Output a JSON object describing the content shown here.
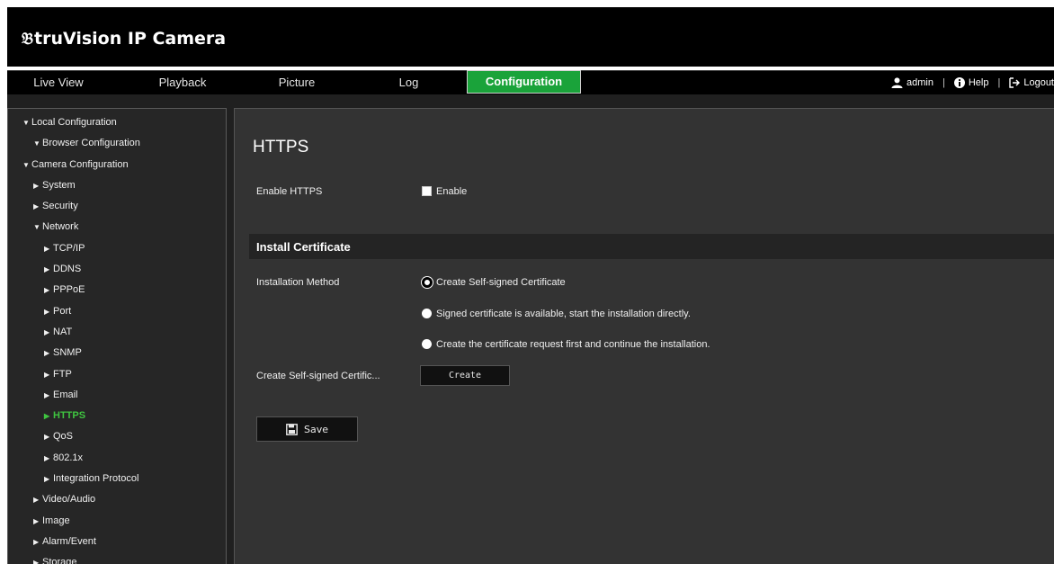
{
  "header": {
    "logo_mark": "𝔅",
    "logo_text": "truVision  IP Camera"
  },
  "nav": {
    "tabs": [
      {
        "label": "Live View"
      },
      {
        "label": "Playback"
      },
      {
        "label": "Picture"
      },
      {
        "label": "Log"
      },
      {
        "label": "Configuration"
      }
    ],
    "user": "admin",
    "help": "Help",
    "logout": "Logout",
    "sep": "|"
  },
  "sidebar": {
    "items": [
      {
        "label": "Local Configuration",
        "indent": 0,
        "expanded": true
      },
      {
        "label": "Browser Configuration",
        "indent": 1,
        "expanded": true
      },
      {
        "label": "Camera Configuration",
        "indent": 0,
        "expanded": true
      },
      {
        "label": "System",
        "indent": 1,
        "expanded": false
      },
      {
        "label": "Security",
        "indent": 1,
        "expanded": false
      },
      {
        "label": "Network",
        "indent": 1,
        "expanded": true
      },
      {
        "label": "TCP/IP",
        "indent": 2,
        "expanded": false
      },
      {
        "label": "DDNS",
        "indent": 2,
        "expanded": false
      },
      {
        "label": "PPPoE",
        "indent": 2,
        "expanded": false
      },
      {
        "label": "Port",
        "indent": 2,
        "expanded": false
      },
      {
        "label": "NAT",
        "indent": 2,
        "expanded": false
      },
      {
        "label": "SNMP",
        "indent": 2,
        "expanded": false
      },
      {
        "label": "FTP",
        "indent": 2,
        "expanded": false
      },
      {
        "label": "Email",
        "indent": 2,
        "expanded": false
      },
      {
        "label": "HTTPS",
        "indent": 2,
        "expanded": false,
        "selected": true
      },
      {
        "label": "QoS",
        "indent": 2,
        "expanded": false
      },
      {
        "label": "802.1x",
        "indent": 2,
        "expanded": false
      },
      {
        "label": "Integration Protocol",
        "indent": 2,
        "expanded": false
      },
      {
        "label": "Video/Audio",
        "indent": 1,
        "expanded": false
      },
      {
        "label": "Image",
        "indent": 1,
        "expanded": false
      },
      {
        "label": "Alarm/Event",
        "indent": 1,
        "expanded": false
      },
      {
        "label": "Storage",
        "indent": 1,
        "expanded": false
      }
    ]
  },
  "main": {
    "title": "HTTPS",
    "enable_https_label": "Enable HTTPS",
    "enable_label": "Enable",
    "section_title": "Install Certificate",
    "install_method_label": "Installation Method",
    "options": [
      "Create Self-signed Certificate",
      "Signed certificate is available, start the installation directly.",
      "Create the certificate request first and continue the installation."
    ],
    "create_label": "Create Self-signed Certific...",
    "create_button": "Create",
    "save_button": "Save"
  },
  "colors": {
    "accent": "#1aa33a",
    "selected_text": "#3fc440"
  }
}
